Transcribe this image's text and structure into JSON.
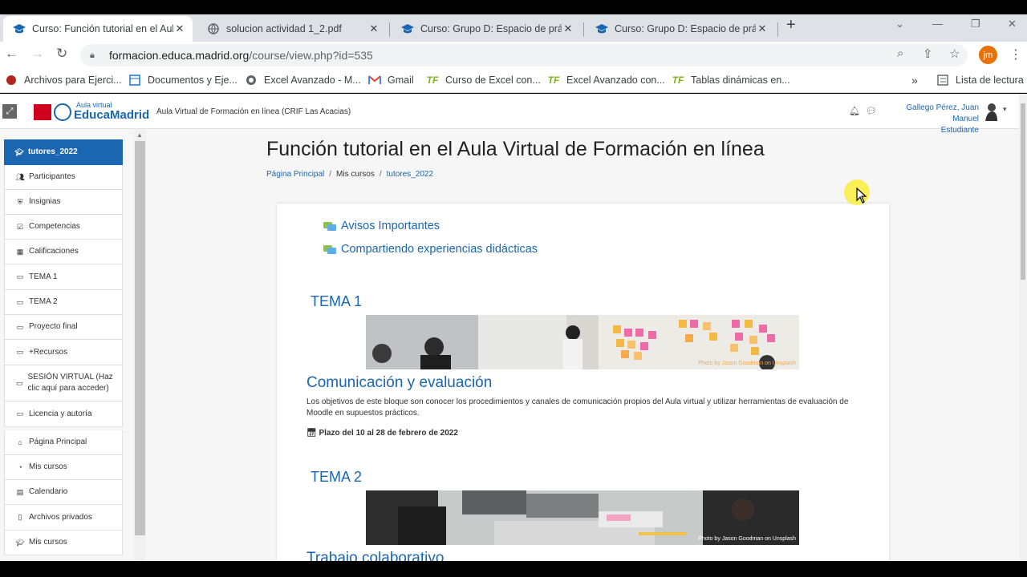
{
  "browser": {
    "tabs": [
      {
        "label": "Curso: Función tutorial en el Aula",
        "active": true
      },
      {
        "label": "solucion actividad 1_2.pdf",
        "active": false
      },
      {
        "label": "Curso: Grupo D: Espacio de práct",
        "active": false
      },
      {
        "label": "Curso: Grupo D: Espacio de práct",
        "active": false
      }
    ],
    "url_host": "formacion.educa.madrid.org",
    "url_path": "/course/view.php?id=535",
    "avatar_initials": "jm",
    "bookmarks": [
      {
        "label": "Archivos para Ejerci...",
        "icon": "red-globe-icon"
      },
      {
        "label": "Documentos y Eje...",
        "icon": "document-icon"
      },
      {
        "label": "Excel Avanzado - M...",
        "icon": "globe-icon"
      },
      {
        "label": "Gmail",
        "icon": "gmail-icon"
      },
      {
        "label": "Curso de Excel con...",
        "icon": "tf-icon"
      },
      {
        "label": "Excel Avanzado con...",
        "icon": "tf-icon"
      },
      {
        "label": "Tablas dinámicas en...",
        "icon": "tf-icon"
      }
    ],
    "bookmarks_more": "»",
    "reading_list": "Lista de lectura"
  },
  "moodle_header": {
    "logo_top": "Aula virtual",
    "logo_bottom": "EducaMadrid",
    "site_name": "Aula Virtual de Formación en línea (CRIF Las Acacias)",
    "user_name": "Gallego Pérez, Juan Manuel",
    "user_role": "Estudiante"
  },
  "sidebar": {
    "items": [
      {
        "label": "tutores_2022",
        "icon": "graduation-cap-icon",
        "active": true
      },
      {
        "label": "Participantes",
        "icon": "users-icon"
      },
      {
        "label": "Insignias",
        "icon": "shield-icon"
      },
      {
        "label": "Competencias",
        "icon": "checkbox-icon"
      },
      {
        "label": "Calificaciones",
        "icon": "table-icon"
      },
      {
        "label": "TEMA 1",
        "icon": "folder-icon"
      },
      {
        "label": "TEMA 2",
        "icon": "folder-icon"
      },
      {
        "label": "Proyecto final",
        "icon": "folder-icon"
      },
      {
        "label": "+Recursos",
        "icon": "folder-icon"
      },
      {
        "label": "SESIÓN VIRTUAL (Haz clic aquí para acceder)",
        "icon": "folder-icon"
      },
      {
        "label": "Licencia y autoría",
        "icon": "folder-icon"
      },
      {
        "label": "Página Principal",
        "icon": "home-icon"
      },
      {
        "label": "Mis cursos",
        "icon": "tachometer-icon"
      },
      {
        "label": "Calendario",
        "icon": "calendar-icon"
      },
      {
        "label": "Archivos privados",
        "icon": "file-icon"
      },
      {
        "label": "Mis cursos",
        "icon": "graduation-cap-icon"
      }
    ]
  },
  "main": {
    "title": "Función tutorial en el Aula Virtual de Formación en línea",
    "breadcrumb": [
      "Página Principal",
      "Mis cursos",
      "tutores_2022"
    ],
    "forums": [
      "Avisos Importantes",
      "Compartiendo experiencias didácticas"
    ],
    "sections": [
      {
        "heading": "TEMA 1",
        "title": "Comunicación y evaluación",
        "description": "Los objetivos de este bloque son conocer los procedimientos y canales de comunicación propios del Aula virtual y utilizar herramientas de evaluación de Moodle en supuestos prácticos.",
        "deadline": "Plazo del 10 al 28 de febrero de 2022",
        "image_credit": "Photo by Jason Goodman on Unsplash"
      },
      {
        "heading": "TEMA 2",
        "title": "Trabajo colaborativo",
        "image_credit": "Photo by Jason Goodman on Unsplash"
      }
    ]
  },
  "colors": {
    "accent": "#1a66b0",
    "brand_red": "#d3001d",
    "page_bg": "#f6f6f6"
  }
}
